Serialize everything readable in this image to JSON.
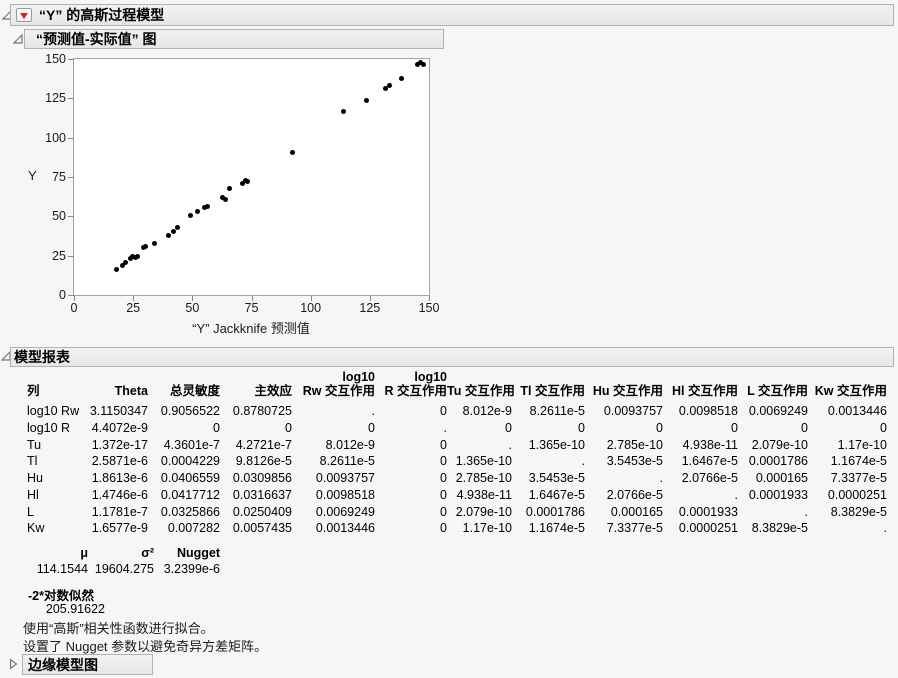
{
  "sections": {
    "main": {
      "title": "“Y” 的高斯过程模型"
    },
    "plot": {
      "title": "“预测值-实际值” 图"
    },
    "report": {
      "title": "模型报表"
    },
    "marginal": {
      "title": "边缘模型图"
    }
  },
  "icons": {
    "menu_button": "red-triangle-menu-icon",
    "expanded": "disclosure-expanded-icon",
    "collapsed": "disclosure-collapsed-icon"
  },
  "chart_data": {
    "type": "scatter",
    "title": "“预测值-实际值” 图",
    "xlabel": "“Y” Jackknife 预测值",
    "ylabel": "Y",
    "xlim": [
      0,
      150
    ],
    "ylim": [
      0,
      150
    ],
    "x_ticks": [
      0,
      25,
      50,
      75,
      100,
      125,
      150
    ],
    "y_ticks": [
      0,
      25,
      50,
      75,
      100,
      125,
      150
    ],
    "grid": false,
    "marker_color": "#000000",
    "points": [
      [
        17.8,
        16.5
      ],
      [
        20.3,
        18.5
      ],
      [
        21.8,
        20.5
      ],
      [
        23.7,
        23.0
      ],
      [
        24.9,
        24.6
      ],
      [
        25.9,
        23.6
      ],
      [
        27.0,
        24.6
      ],
      [
        29.2,
        30.0
      ],
      [
        30.2,
        31.0
      ],
      [
        34.0,
        32.5
      ],
      [
        39.8,
        38.0
      ],
      [
        42.0,
        40.5
      ],
      [
        43.8,
        42.8
      ],
      [
        49.2,
        50.8
      ],
      [
        52.3,
        53.0
      ],
      [
        55.0,
        55.6
      ],
      [
        56.6,
        56.2
      ],
      [
        62.8,
        62.0
      ],
      [
        64.0,
        61.0
      ],
      [
        65.6,
        67.4
      ],
      [
        71.0,
        71.0
      ],
      [
        72.3,
        72.6
      ],
      [
        73.3,
        72.0
      ],
      [
        92.3,
        90.4
      ],
      [
        114.0,
        116.4
      ],
      [
        123.8,
        123.5
      ],
      [
        131.8,
        131.4
      ],
      [
        133.3,
        133.0
      ],
      [
        138.2,
        137.4
      ],
      [
        145.3,
        146.8
      ],
      [
        146.6,
        147.8
      ],
      [
        147.6,
        146.8
      ]
    ]
  },
  "report_table": {
    "header_top": [
      "",
      "",
      "",
      "",
      "log10",
      "log10",
      "",
      "",
      "",
      "",
      "",
      ""
    ],
    "header": [
      "列",
      "Theta",
      "总灵敏度",
      "主效应",
      "Rw 交互作用",
      "R 交互作用",
      "Tu 交互作用",
      "Tl 交互作用",
      "Hu 交互作用",
      "Hl 交互作用",
      "L 交互作用",
      "Kw 交互作用"
    ],
    "rows": [
      [
        "log10 Rw",
        "3.1150347",
        "0.9056522",
        "0.8780725",
        ".",
        "0",
        "8.012e-9",
        "8.2611e-5",
        "0.0093757",
        "0.0098518",
        "0.0069249",
        "0.0013446"
      ],
      [
        "log10 R",
        "4.4072e-9",
        "0",
        "0",
        "0",
        ".",
        "0",
        "0",
        "0",
        "0",
        "0",
        "0"
      ],
      [
        "Tu",
        "1.372e-17",
        "4.3601e-7",
        "4.2721e-7",
        "8.012e-9",
        "0",
        ".",
        "1.365e-10",
        "2.785e-10",
        "4.938e-11",
        "2.079e-10",
        "1.17e-10"
      ],
      [
        "Tl",
        "2.5871e-6",
        "0.0004229",
        "9.8126e-5",
        "8.2611e-5",
        "0",
        "1.365e-10",
        ".",
        "3.5453e-5",
        "1.6467e-5",
        "0.0001786",
        "1.1674e-5"
      ],
      [
        "Hu",
        "1.8613e-6",
        "0.0406559",
        "0.0309856",
        "0.0093757",
        "0",
        "2.785e-10",
        "3.5453e-5",
        ".",
        "2.0766e-5",
        "0.000165",
        "7.3377e-5"
      ],
      [
        "Hl",
        "1.4746e-6",
        "0.0417712",
        "0.0316637",
        "0.0098518",
        "0",
        "4.938e-11",
        "1.6467e-5",
        "2.0766e-5",
        ".",
        "0.0001933",
        "0.0000251"
      ],
      [
        "L",
        "1.1781e-7",
        "0.0325866",
        "0.0250409",
        "0.0069249",
        "0",
        "2.079e-10",
        "0.0001786",
        "0.000165",
        "0.0001933",
        ".",
        "8.3829e-5"
      ],
      [
        "Kw",
        "1.6577e-9",
        "0.007282",
        "0.0057435",
        "0.0013446",
        "0",
        "1.17e-10",
        "1.1674e-5",
        "7.3377e-5",
        "0.0000251",
        "8.3829e-5",
        "."
      ]
    ]
  },
  "param_table": {
    "header": [
      "μ",
      "σ²",
      "Nugget"
    ],
    "values": [
      "114.1544",
      "19604.275",
      "3.2399e-6"
    ]
  },
  "likelihood": {
    "label": "-2*对数似然",
    "value": "205.91622"
  },
  "notes": [
    "使用“高斯”相关性函数进行拟合。",
    "设置了 Nugget 参数以避免奇异方差矩阵。"
  ],
  "colors": {
    "accent_red": "#c8251f",
    "bar_border": "#b2b2b2",
    "plot_frame": "#a3a3a3",
    "marker": "#000000"
  }
}
